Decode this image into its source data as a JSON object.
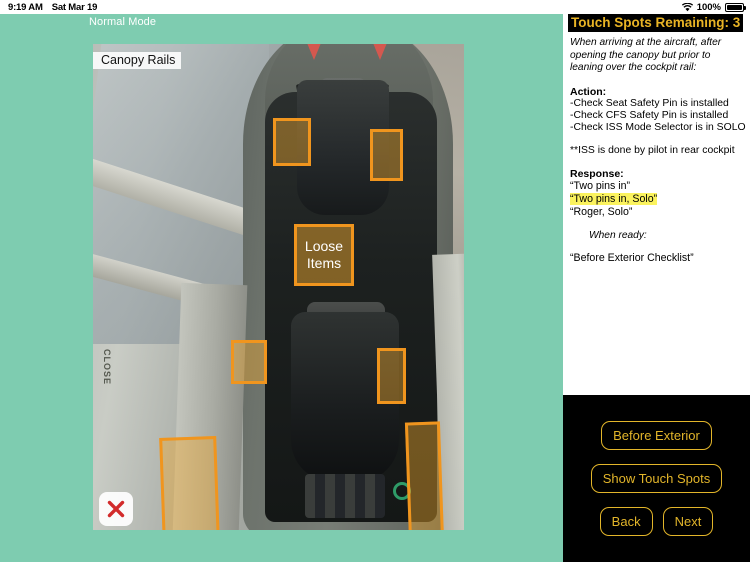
{
  "status_bar": {
    "time": "9:19 AM",
    "date": "Sat Mar 19",
    "battery_percent": "100%",
    "wifi_icon": "wifi-icon",
    "battery_icon": "battery-full-icon"
  },
  "stage": {
    "mode_label": "Normal Mode",
    "background_color": "#7ECCB0"
  },
  "photo_viewer": {
    "title": "Canopy Rails",
    "close_icon": "close-x-icon",
    "overlay_label_line1": "Loose",
    "overlay_label_line2": "Items",
    "highlight_color": "#F0951E",
    "highlight_count": 6
  },
  "info_panel": {
    "header": "Touch Spots Remaining: 3",
    "header_bg": "#000000",
    "header_color": "#E9B425",
    "intro": "When arriving at the aircraft, after opening the canopy but prior to leaning over the cockpit rail:",
    "action_title": "Action:",
    "actions": [
      "-Check Seat Safety Pin is installed",
      "-Check CFS Safety Pin is installed",
      "-Check ISS Mode Selector is in SOLO"
    ],
    "note": "**ISS is done by pilot in rear cockpit",
    "response_title": "Response:",
    "responses": [
      "“Two pins in”",
      "“Two pins in, Solo”",
      "“Roger, Solo”"
    ],
    "highlighted_response": "“Two pins in, Solo”",
    "highlight_color": "#FBF35E",
    "when_ready": "When ready:",
    "final_line": "“Before Exterior Checklist”"
  },
  "button_panel": {
    "background": "#000000",
    "accent": "#E2B52A",
    "before_exterior": "Before Exterior",
    "show_touch_spots": "Show Touch Spots",
    "back": "Back",
    "next": "Next"
  }
}
